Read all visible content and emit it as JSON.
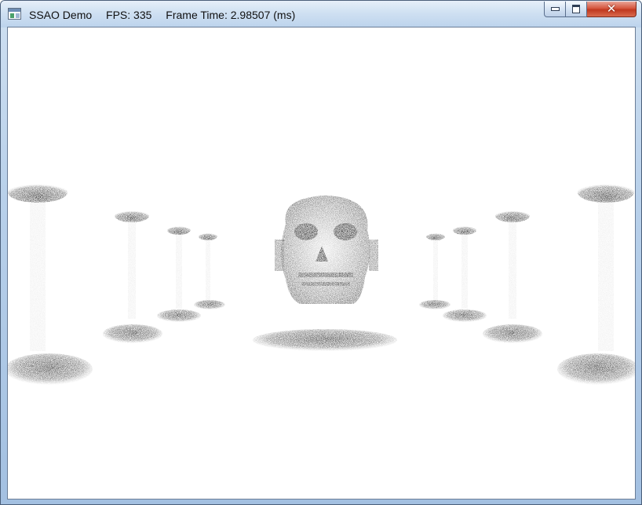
{
  "window": {
    "title": "SSAO Demo",
    "fps": "FPS: 335",
    "frame_time": "Frame Time: 2.98507 (ms)"
  },
  "controls": {
    "minimize_icon": "minimize-icon",
    "maximize_icon": "maximize-icon",
    "close_icon": "close-icon",
    "close_glyph": "✕"
  },
  "scene": {
    "description_icon": "ssao-render-viewport",
    "colors": {
      "occlusion": "#222222",
      "background": "#ffffff"
    }
  }
}
